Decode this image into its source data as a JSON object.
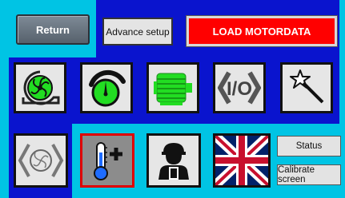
{
  "header": {
    "return_label": "Return",
    "advance_setup_label": "Advance setup",
    "load_motordata_label": "LOAD MOTORDATA"
  },
  "side_buttons": {
    "status_label": "Status",
    "calibrate_label": "Calibrate screen"
  },
  "icons": {
    "row1": [
      "pump-icon",
      "speed-gauge-icon",
      "motor-icon",
      "io-icon",
      "magic-wand-icon"
    ],
    "row2": [
      "pump-outline-icon",
      "temperature-plus-icon",
      "service-technician-icon",
      "uk-flag-icon"
    ]
  },
  "colors": {
    "background_blue": "#0a14ce",
    "panel_cyan": "#00c4e4",
    "load_red": "#ff0000",
    "icon_green": "#22dd22"
  }
}
